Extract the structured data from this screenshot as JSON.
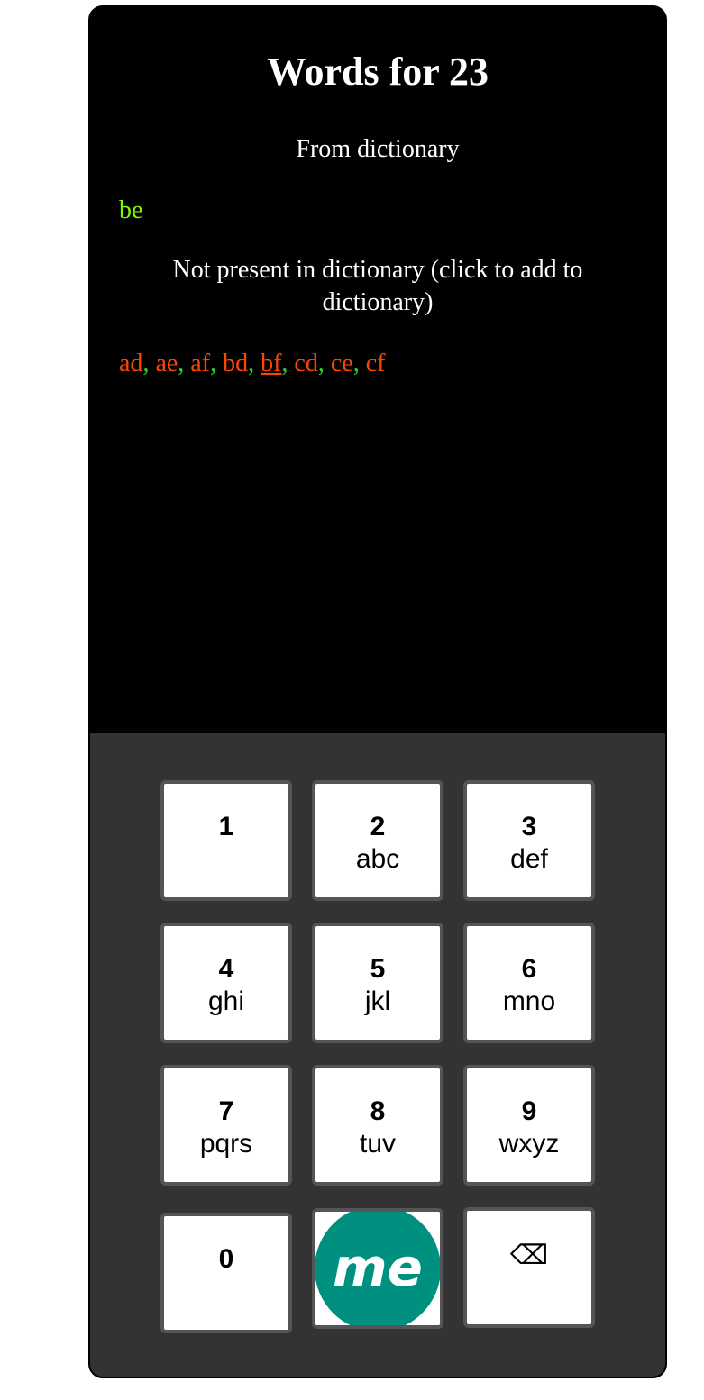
{
  "header": {
    "title": "Words for 23"
  },
  "dictionary": {
    "heading": "From dictionary",
    "words": [
      "be"
    ]
  },
  "not_in_dictionary": {
    "heading": "Not present in dictionary (click to add to dictionary)",
    "words": [
      "ad",
      "ae",
      "af",
      "bd",
      "bf",
      "cd",
      "ce",
      "cf"
    ],
    "separator": ","
  },
  "keypad": {
    "keys": [
      {
        "num": "1",
        "letters": ""
      },
      {
        "num": "2",
        "letters": "abc"
      },
      {
        "num": "3",
        "letters": "def"
      },
      {
        "num": "4",
        "letters": "ghi"
      },
      {
        "num": "5",
        "letters": "jkl"
      },
      {
        "num": "6",
        "letters": "mno"
      },
      {
        "num": "7",
        "letters": "pqrs"
      },
      {
        "num": "8",
        "letters": "tuv"
      },
      {
        "num": "9",
        "letters": "wxyz"
      },
      {
        "num": "0",
        "letters": ""
      }
    ],
    "me_logo_text": "me",
    "backspace_symbol": "⌫"
  },
  "colors": {
    "found_word": "#7cfc00",
    "missing_word": "#ff4500",
    "separator": "#32cd32",
    "logo_teal": "#009080"
  }
}
